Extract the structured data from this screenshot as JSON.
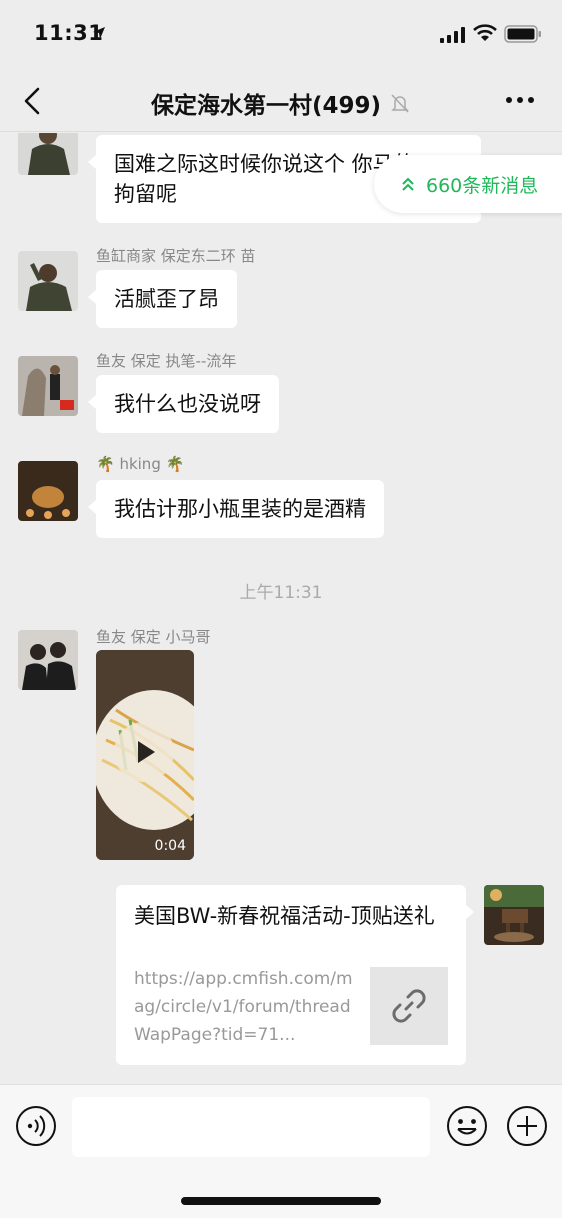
{
  "status_bar": {
    "time": "11:31"
  },
  "nav": {
    "title": "保定海水第一村(499)"
  },
  "new_messages": "660条新消息",
  "messages": [
    {
      "sender": "",
      "text": "国难之际这时候你说这个 你马的\n拘留呢"
    },
    {
      "sender": "鱼缸商家 保定东二环  苗",
      "text": "活腻歪了昂"
    },
    {
      "sender": "鱼友 保定 执笔--流年",
      "text": "我什么也没说呀"
    },
    {
      "sender": "🌴 hking 🌴",
      "text": "我估计那小瓶里装的是酒精"
    }
  ],
  "timestamp": "上午11:31",
  "video_msg": {
    "sender": "鱼友 保定 小马哥",
    "duration": "0:04"
  },
  "link_card": {
    "title": "美国BW-新春祝福活动-顶贴送礼",
    "desc": "https://app.cmfish.com/mag/circle/v1/forum/threadWapPage?tid=71..."
  },
  "input": {
    "value": ""
  },
  "colors": {
    "accent": "#20b85a",
    "background": "#ededed",
    "bubble": "#ffffff"
  }
}
